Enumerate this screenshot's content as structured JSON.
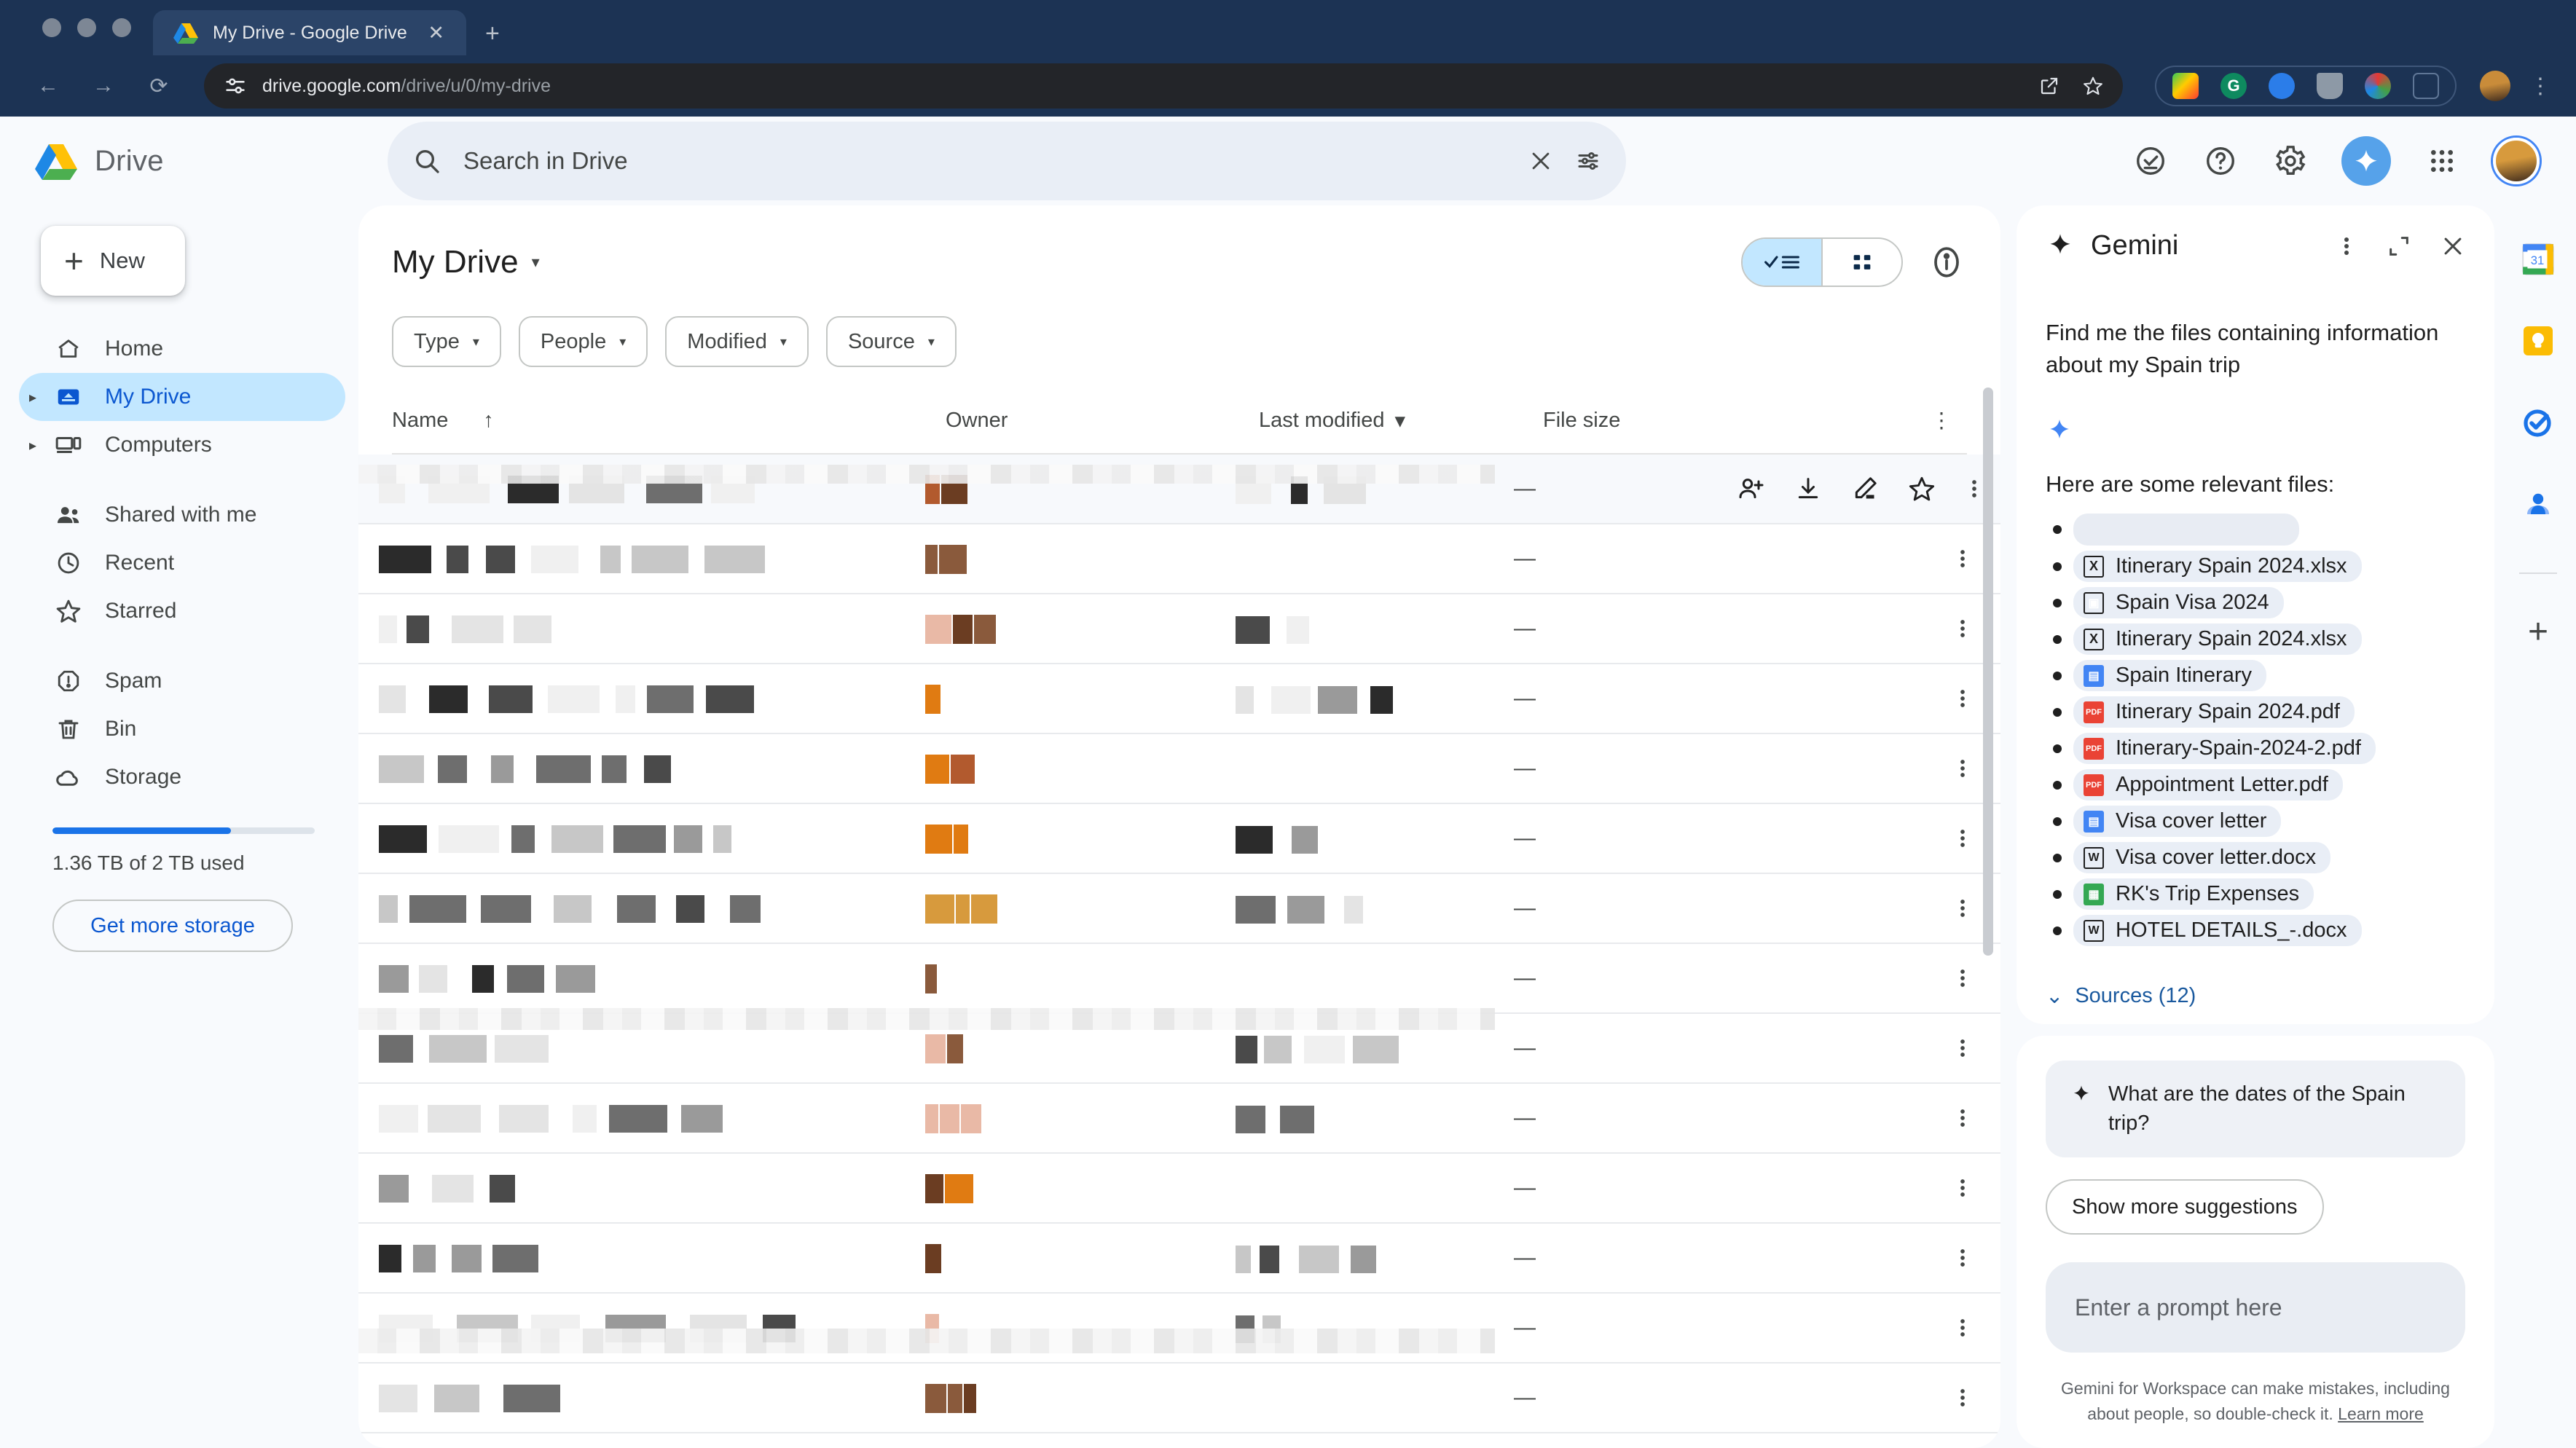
{
  "browser": {
    "tab": {
      "title": "My Drive - Google Drive",
      "favicon": "drive-icon",
      "close": "✕",
      "new_tab": "+"
    },
    "nav": {
      "back": "←",
      "forward": "→",
      "reload": "⟳"
    },
    "url": {
      "domain": "drive.google.com",
      "path": "/drive/u/0/my-drive",
      "site_info_icon": "tune-icon"
    },
    "url_actions": {
      "share": "share-icon",
      "bookmark": "star-icon"
    },
    "extensions": [
      "extension-colorful",
      "grammarly",
      "privacy-badger",
      "shield",
      "colorzilla",
      "puzzle-piece"
    ],
    "profile": "chrome-profile-avatar",
    "menu": "⋮"
  },
  "drive_header": {
    "logo": "google-drive-logo",
    "wordmark": "Drive",
    "search": {
      "placeholder": "Search in Drive",
      "icon": "search-icon",
      "clear": "✕",
      "options": "tune-icon"
    },
    "icons": [
      "active-tasks-icon",
      "help-icon",
      "settings-icon",
      "gemini-icon",
      "apps-grid-icon",
      "account-avatar"
    ]
  },
  "sidebar": {
    "new_button": {
      "label": "New",
      "icon": "plus-icon"
    },
    "items": [
      {
        "label": "Home",
        "icon": "home-icon",
        "active": false,
        "expandable": false
      },
      {
        "label": "My Drive",
        "icon": "my-drive-icon",
        "active": true,
        "expandable": true
      },
      {
        "label": "Computers",
        "icon": "computers-icon",
        "active": false,
        "expandable": true
      },
      {
        "label": "Shared with me",
        "icon": "people-icon",
        "active": false,
        "expandable": false
      },
      {
        "label": "Recent",
        "icon": "clock-icon",
        "active": false,
        "expandable": false
      },
      {
        "label": "Starred",
        "icon": "star-icon",
        "active": false,
        "expandable": false
      },
      {
        "label": "Spam",
        "icon": "spam-icon",
        "active": false,
        "expandable": false
      },
      {
        "label": "Bin",
        "icon": "trash-icon",
        "active": false,
        "expandable": false
      },
      {
        "label": "Storage",
        "icon": "cloud-icon",
        "active": false,
        "expandable": false
      }
    ],
    "storage": {
      "used_text": "1.36 TB of 2 TB used",
      "percent": 68,
      "cta": "Get more storage"
    }
  },
  "main": {
    "title": "My Drive",
    "title_caret": "▾",
    "view_toggle": {
      "list_selected": true,
      "list_icon": "list-view-icon",
      "grid_icon": "grid-view-icon"
    },
    "info_icon": "info-icon",
    "filters": [
      {
        "label": "Type",
        "caret": "▾"
      },
      {
        "label": "People",
        "caret": "▾"
      },
      {
        "label": "Modified",
        "caret": "▾"
      },
      {
        "label": "Source",
        "caret": "▾"
      }
    ],
    "columns": {
      "name": "Name",
      "name_sort": "↑",
      "owner": "Owner",
      "modified": "Last modified",
      "modified_caret": "▾",
      "size": "File size",
      "kebab": "⋮"
    },
    "row_actions": [
      "share-person-add-icon",
      "download-icon",
      "edit-pencil-icon",
      "star-icon",
      "more-kebab-icon"
    ],
    "rows": [
      {
        "name": "",
        "owner": "",
        "modified": "",
        "size": "—",
        "redacted": true,
        "hovered": true
      },
      {
        "name": "",
        "owner": "",
        "modified": "",
        "size": "—",
        "redacted": true,
        "hovered": false
      },
      {
        "name": "",
        "owner": "",
        "modified": "",
        "size": "—",
        "redacted": true,
        "hovered": false
      },
      {
        "name": "",
        "owner": "",
        "modified": "",
        "size": "—",
        "redacted": true,
        "hovered": false
      },
      {
        "name": "",
        "owner": "",
        "modified": "",
        "size": "—",
        "redacted": true,
        "hovered": false
      },
      {
        "name": "",
        "owner": "",
        "modified": "",
        "size": "—",
        "redacted": true,
        "hovered": false
      },
      {
        "name": "",
        "owner": "",
        "modified": "",
        "size": "—",
        "redacted": true,
        "hovered": false
      },
      {
        "name": "",
        "owner": "",
        "modified": "",
        "size": "—",
        "redacted": true,
        "hovered": false
      },
      {
        "name": "",
        "owner": "",
        "modified": "",
        "size": "—",
        "redacted": true,
        "hovered": false
      },
      {
        "name": "",
        "owner": "",
        "modified": "",
        "size": "—",
        "redacted": true,
        "hovered": false
      },
      {
        "name": "",
        "owner": "",
        "modified": "",
        "size": "—",
        "redacted": true,
        "hovered": false
      },
      {
        "name": "",
        "owner": "",
        "modified": "",
        "size": "—",
        "redacted": true,
        "hovered": false
      },
      {
        "name": "",
        "owner": "",
        "modified": "",
        "size": "—",
        "redacted": true,
        "hovered": false
      },
      {
        "name": "",
        "owner": "",
        "modified": "",
        "size": "—",
        "redacted": true,
        "hovered": false
      }
    ]
  },
  "gemini": {
    "title": "Gemini",
    "spark_icon": "gemini-spark-icon",
    "header_icons": {
      "more": "⋮",
      "expand": "expand-icon",
      "close": "✕"
    },
    "user_prompt": "Find me the files containing information about my Spain trip",
    "answer_intro": "Here are some relevant files:",
    "files": [
      {
        "name": "",
        "type": "redacted"
      },
      {
        "name": "Itinerary Spain 2024.xlsx",
        "type": "xls"
      },
      {
        "name": "Spain Visa 2024",
        "type": "folder"
      },
      {
        "name": "Itinerary Spain 2024.xlsx",
        "type": "xls"
      },
      {
        "name": "Spain Itinerary",
        "type": "doc"
      },
      {
        "name": "Itinerary Spain 2024.pdf",
        "type": "pdf"
      },
      {
        "name": "Itinerary-Spain-2024-2.pdf",
        "type": "pdf"
      },
      {
        "name": "Appointment Letter.pdf",
        "type": "pdf"
      },
      {
        "name": "Visa cover letter",
        "type": "doc"
      },
      {
        "name": "Visa cover letter.docx",
        "type": "docx"
      },
      {
        "name": "RK's Trip Expenses",
        "type": "sheet"
      },
      {
        "name": "HOTEL DETAILS_-.docx",
        "type": "docx"
      }
    ],
    "sources": {
      "label": "Sources (12)",
      "caret": "⌄"
    },
    "actions": {
      "left": [
        "check-sources-icon",
        "search-related-icon"
      ],
      "right": [
        "thumbs-up-icon",
        "thumbs-down-icon"
      ]
    },
    "suggestion": "What are the dates of the Spain trip?",
    "show_more": "Show more suggestions",
    "prompt_placeholder": "Enter a prompt here",
    "disclaimer_text": "Gemini for Workspace can make mistakes, including about people, so double-check it.",
    "disclaimer_link": "Learn more"
  },
  "right_rail": {
    "items": [
      "google-calendar-icon",
      "google-keep-icon",
      "google-tasks-icon",
      "google-contacts-icon"
    ],
    "add": "+"
  },
  "colors": {
    "accent_blue": "#0b57d0",
    "chrome_bg": "#1c3354",
    "panel_bg": "#f8fafd",
    "selected_nav": "#c2e7ff",
    "gemini_blue": "#56a2ea",
    "pdf_red": "#ea4335",
    "sheet_green": "#34a853"
  }
}
